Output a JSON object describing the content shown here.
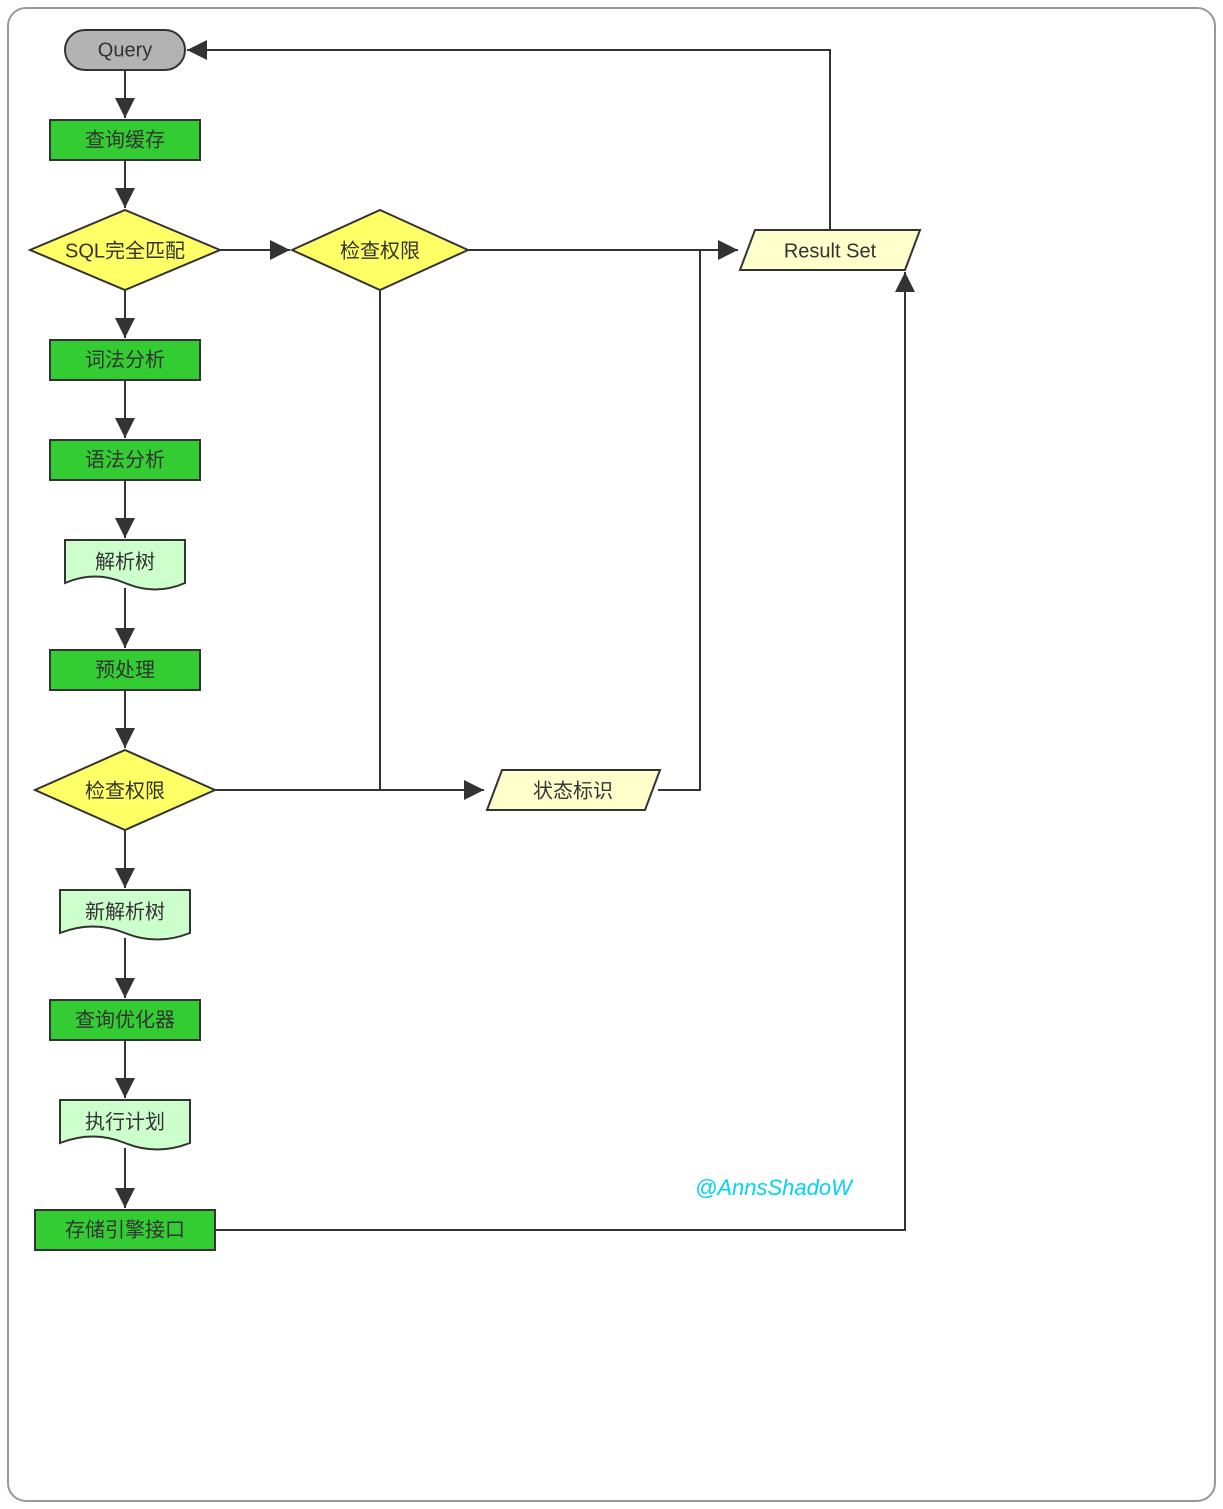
{
  "nodes": {
    "start": {
      "label": "Query"
    },
    "queryCache": {
      "label": "查询缓存"
    },
    "sqlMatch": {
      "label": "SQL完全匹配"
    },
    "checkPerm1": {
      "label": "检查权限"
    },
    "resultSet": {
      "label": "Result Set"
    },
    "lexical": {
      "label": "词法分析"
    },
    "syntax": {
      "label": "语法分析"
    },
    "parseTree": {
      "label": "解析树"
    },
    "preprocess": {
      "label": "预处理"
    },
    "checkPerm2": {
      "label": "检查权限"
    },
    "statusFlag": {
      "label": "状态标识"
    },
    "newParseTree": {
      "label": "新解析树"
    },
    "optimizer": {
      "label": "查询优化器"
    },
    "execPlan": {
      "label": "执行计划"
    },
    "storageEngine": {
      "label": "存储引擎接口"
    }
  },
  "watermark": "@AnnsShadoW",
  "colors": {
    "startFill": "#b3b3b3",
    "processFill": "#33cc33",
    "processLight": "#ccffcc",
    "decisionFill": "#ffff66",
    "dataFill": "#ffffcc",
    "border": "#333333"
  }
}
